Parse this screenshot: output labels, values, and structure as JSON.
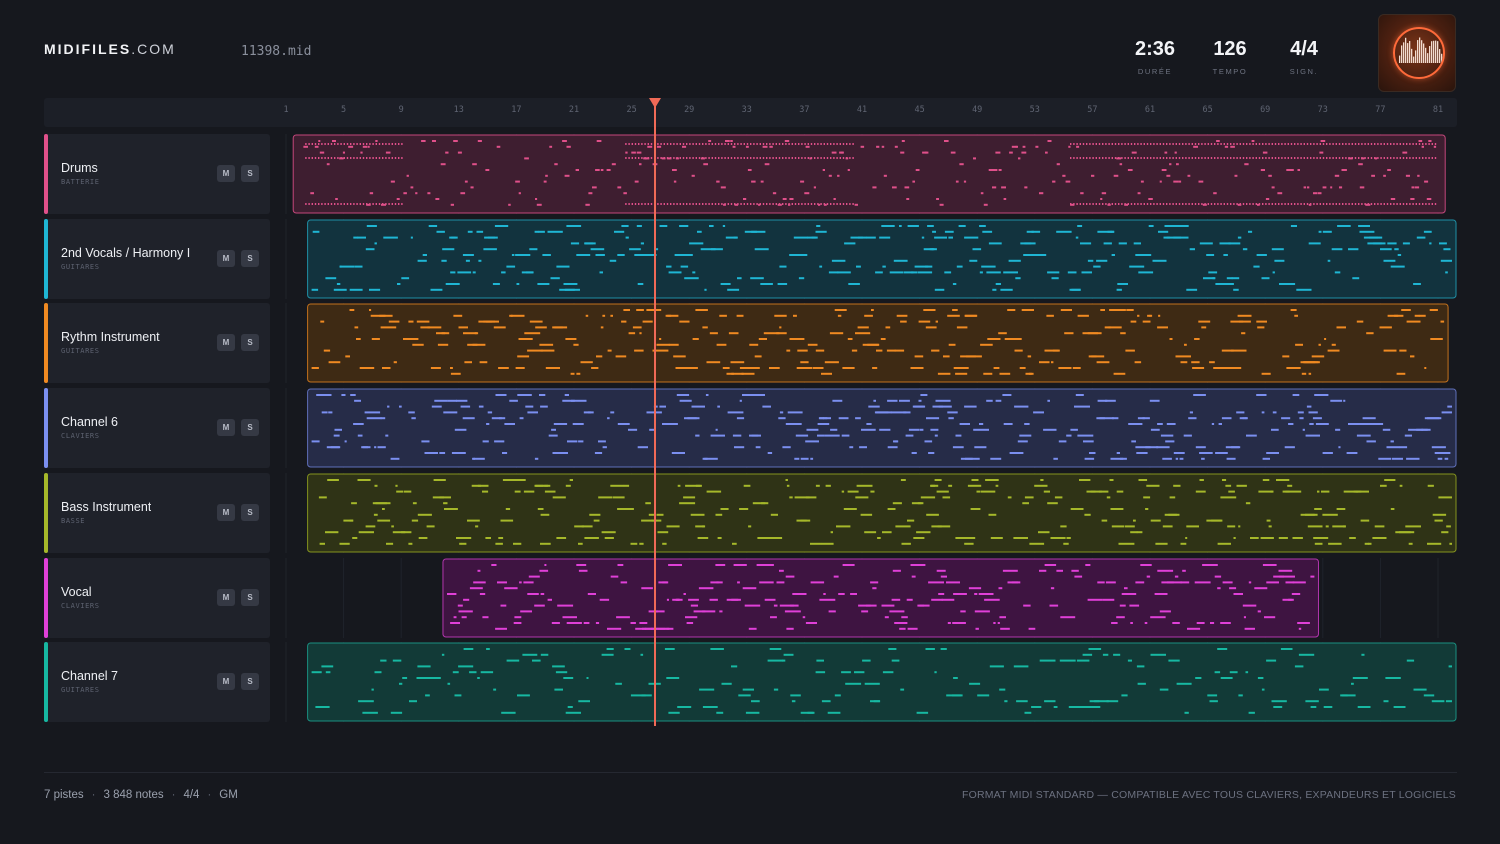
{
  "brand": {
    "bold": "MIDIFILES",
    "rest": ".COM"
  },
  "file": {
    "name": "11398.mid"
  },
  "stats": [
    {
      "value": "2:36",
      "label": "DURÉE"
    },
    {
      "value": "126",
      "label": "TEMPO"
    },
    {
      "value": "4/4",
      "label": "SIGN."
    }
  ],
  "thumbnail": {
    "icon": "waveform-cover-icon",
    "accent": "#ff6a3a"
  },
  "ruler": {
    "ticks": [
      "1",
      "5",
      "9",
      "13",
      "17",
      "21",
      "25",
      "29",
      "33",
      "37",
      "41",
      "45",
      "49",
      "53",
      "57",
      "61",
      "65",
      "69",
      "73",
      "77",
      "81"
    ]
  },
  "playhead": {
    "bar": 27
  },
  "tracks": [
    {
      "name": "Drums",
      "category": "BATTERIE",
      "color": "#e0508a",
      "fill": "#3e1e30",
      "border": "#c4477b",
      "start_bar": 1.5,
      "end_bar": 81.5,
      "mute": "M",
      "solo": "S"
    },
    {
      "name": "2nd Vocals / Harmony I",
      "category": "GUITARES",
      "color": "#1fb6d4",
      "fill": "#12333e",
      "border": "#1f8fa6",
      "start_bar": 2.5,
      "end_bar": 82.5,
      "mute": "M",
      "solo": "S"
    },
    {
      "name": "Rythm Instrument",
      "category": "GUITARES",
      "color": "#f08a22",
      "fill": "#3e2a14",
      "border": "#c2711d",
      "start_bar": 2.5,
      "end_bar": 81.7,
      "mute": "M",
      "solo": "S"
    },
    {
      "name": "Channel 6",
      "category": "CLAVIERS",
      "color": "#7b8ff0",
      "fill": "#262c48",
      "border": "#5f6fba",
      "start_bar": 2.5,
      "end_bar": 82.5,
      "mute": "M",
      "solo": "S"
    },
    {
      "name": "Bass Instrument",
      "category": "BASSE",
      "color": "#a6b82a",
      "fill": "#2f3316",
      "border": "#84931f",
      "start_bar": 2.5,
      "end_bar": 82.5,
      "mute": "M",
      "solo": "S"
    },
    {
      "name": "Vocal",
      "category": "CLAVIERS",
      "color": "#e040d8",
      "fill": "#3e1441",
      "border": "#b236ad",
      "start_bar": 11.9,
      "end_bar": 72.7,
      "mute": "M",
      "solo": "S"
    },
    {
      "name": "Channel 7",
      "category": "GUITARES",
      "color": "#17b8a2",
      "fill": "#123a37",
      "border": "#1a8f80",
      "start_bar": 2.5,
      "end_bar": 82.5,
      "mute": "M",
      "solo": "S"
    }
  ],
  "footer": {
    "tracks": "7 pistes",
    "notes": "3 848 notes",
    "signature": "4/4",
    "standard": "GM",
    "separator": "·",
    "note": "FORMAT MIDI STANDARD — COMPATIBLE AVEC TOUS CLAVIERS, EXPANDEURS ET LOGICIELS"
  }
}
